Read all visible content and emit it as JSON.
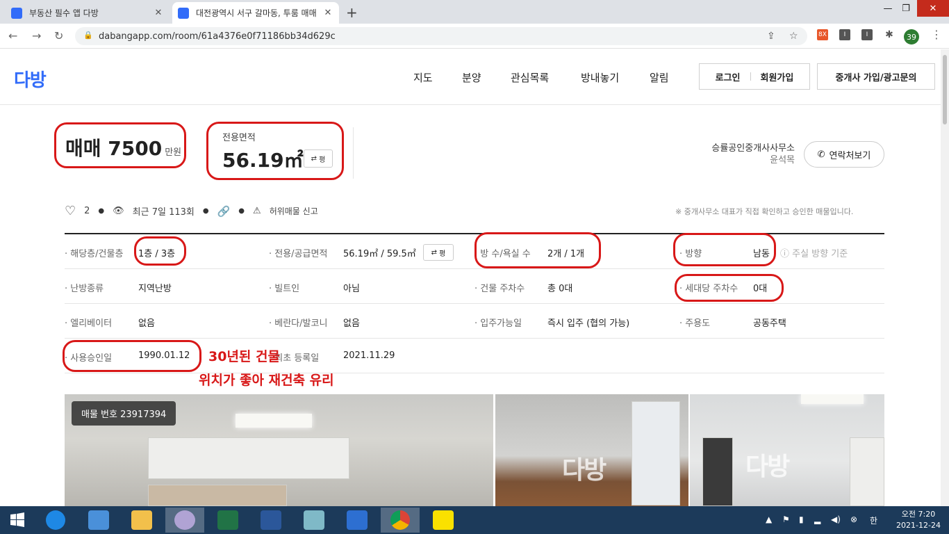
{
  "browser": {
    "tabs": [
      {
        "title": "부동산 필수 앱 다방",
        "close": "✕"
      },
      {
        "title": "대전광역시 서구 갈마동, 투룸 매매",
        "close": "✕"
      }
    ],
    "new_tab": "+",
    "url": "dabangapp.com/room/61a4376e0f71186bb34d629c",
    "profile_badge": "39",
    "ext_badge": "8X"
  },
  "site": {
    "logo": "다방",
    "menu": [
      "지도",
      "분양",
      "관심목록",
      "방내놓기",
      "알림"
    ],
    "login": "로그인",
    "signup": "회원가입",
    "agent": "중개사 가입/광고문의"
  },
  "summary": {
    "price": "매매 7500",
    "price_unit": "만원",
    "area_label": "전용면적",
    "area_value": "56.19㎡",
    "pyeong_btn": "평",
    "agency": "승률공인중개사사무소",
    "agent_name": "윤석목",
    "contact_btn": "연락처보기"
  },
  "stats": {
    "likes": "2",
    "views": "최근 7일 113회",
    "report": "허위매물 신고",
    "note": "※ 중개사무소 대표가 직접 확인하고 승인한 매물입니다."
  },
  "details": {
    "row1": {
      "l1": "해당층/건물층",
      "v1": "1층 / 3층",
      "l2": "전용/공급면적",
      "v2": "56.19㎡ / 59.5㎡",
      "btn": "평",
      "l3": "방 수/욕실 수",
      "v3": "2개 / 1개",
      "l4": "방향",
      "v4": "남동",
      "hint": "ⓘ 주실 방향 기준"
    },
    "row2": {
      "l1": "난방종류",
      "v1": "지역난방",
      "l2": "빌트인",
      "v2": "아님",
      "l3": "건물 주차수",
      "v3": "총 0대",
      "l4": "세대당 주차수",
      "v4": "0대"
    },
    "row3": {
      "l1": "엘리베이터",
      "v1": "없음",
      "l2": "베란다/발코니",
      "v2": "없음",
      "l3": "입주가능일",
      "v3": "즉시 입주 (협의 가능)",
      "l4": "주용도",
      "v4": "공동주택"
    },
    "row4": {
      "l1": "사용승인일",
      "v1": "1990.01.12",
      "l2": "최초 등록일",
      "v2": "2021.11.29"
    }
  },
  "annotations": {
    "line1": "30년된 건물",
    "line2": "위치가 좋아 재건축 유리",
    "color": "#d81818"
  },
  "photos": {
    "badge": "매물 번호 23917394",
    "watermark": "다방"
  },
  "taskbar": {
    "ime": "한",
    "time": "오전 7:20",
    "date": "2021-12-24"
  }
}
